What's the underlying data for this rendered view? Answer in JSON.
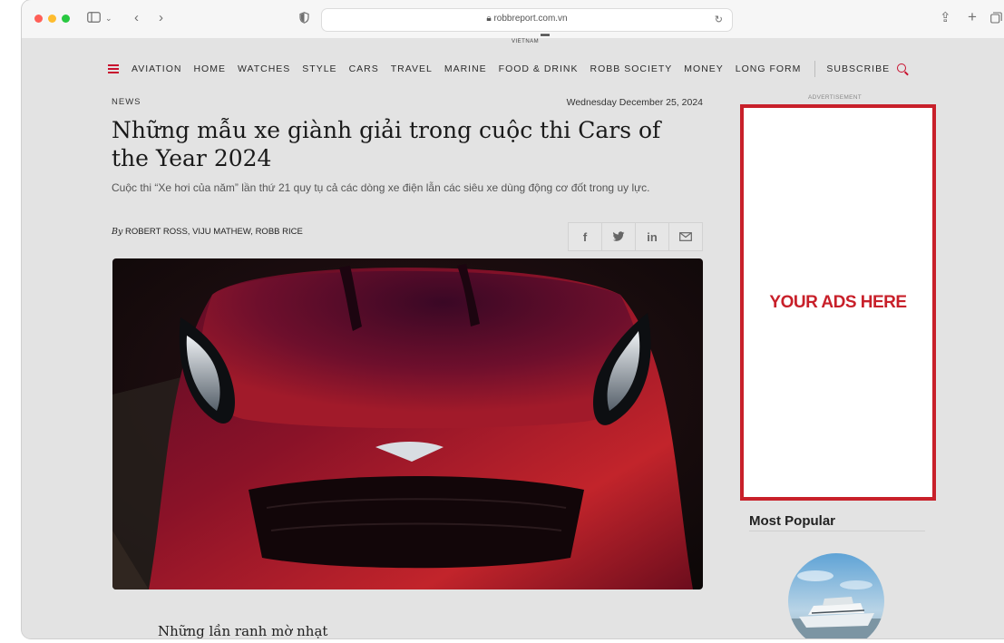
{
  "browser": {
    "url": "robbreport.com.vn",
    "traffic_lights": [
      "#ff5f57",
      "#febc2e",
      "#28c840"
    ]
  },
  "site": {
    "edition": "VIETNAM",
    "accent_color": "#c8102e",
    "nav_items": [
      "AVIATION",
      "HOME",
      "WATCHES",
      "STYLE",
      "CARS",
      "TRAVEL",
      "MARINE",
      "FOOD & DRINK",
      "ROBB SOCIETY",
      "MONEY",
      "LONG FORM"
    ],
    "subscribe_label": "SUBSCRIBE"
  },
  "article": {
    "section": "NEWS",
    "date": "Wednesday December 25, 2024",
    "title": "Những mẫu xe giành giải trong cuộc thi Cars of the Year 2024",
    "subtitle": "Cuộc thi “Xe hơi của năm” lần thứ 21 quy tụ cả các dòng xe điện lẫn các siêu xe dùng động cơ đốt trong uy lực.",
    "byline_prefix": "By",
    "authors": "ROBERT ROSS, VIJU MATHEW, ROBB RICE",
    "share": [
      "f",
      "twitter",
      "in",
      "mail"
    ],
    "next_heading": "Những lần ranh mờ nhạt"
  },
  "sidebar": {
    "ad_label": "ADVERTISEMENT",
    "ad_text": "YOUR ADS HERE",
    "ad_color": "#c8202a",
    "most_popular": "Most Popular"
  }
}
